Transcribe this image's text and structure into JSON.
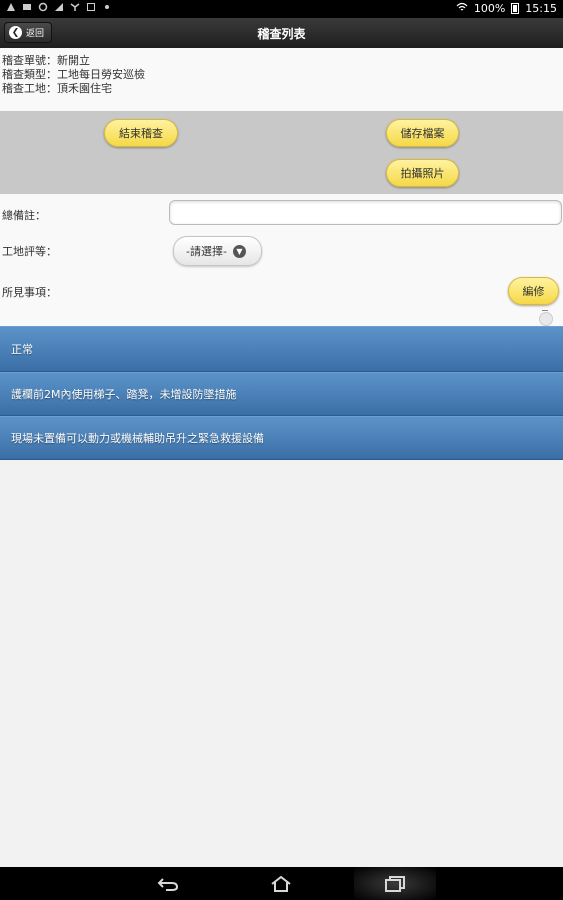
{
  "status_bar": {
    "icons": [
      "notification-icon",
      "mail-icon",
      "sync-icon",
      "chart-icon",
      "fan-icon",
      "square-icon",
      "brightness-icon"
    ],
    "battery": "100%",
    "time": "15:15"
  },
  "header": {
    "back_label": "返回",
    "title": "稽查列表"
  },
  "info": {
    "line1": "稽查單號：新開立",
    "line2": "稽查類型：工地每日勞安巡檢",
    "line3": "稽查工地：頂禾園住宅"
  },
  "actions": {
    "end_inspection": "結束稽查",
    "save_file": "儲存檔案",
    "take_photo": "拍攝照片"
  },
  "form": {
    "remark_label": "總備註：",
    "remark_value": "",
    "rating_label": "工地評等：",
    "rating_selected": "-請選擇-",
    "findings_label": "所見事項：",
    "edit_button": "編修"
  },
  "list": [
    "正常",
    "護欄前2M內使用梯子、踏凳，未增設防墜措施",
    "現場未置備可以動力或機械輔助吊升之緊急救援設備"
  ],
  "colors": {
    "header_bg": "#2a2a2a",
    "action_area_bg": "#c8c8c8",
    "yellow_button": "#f8e27a",
    "list_item_blue": "#4a80b8"
  }
}
